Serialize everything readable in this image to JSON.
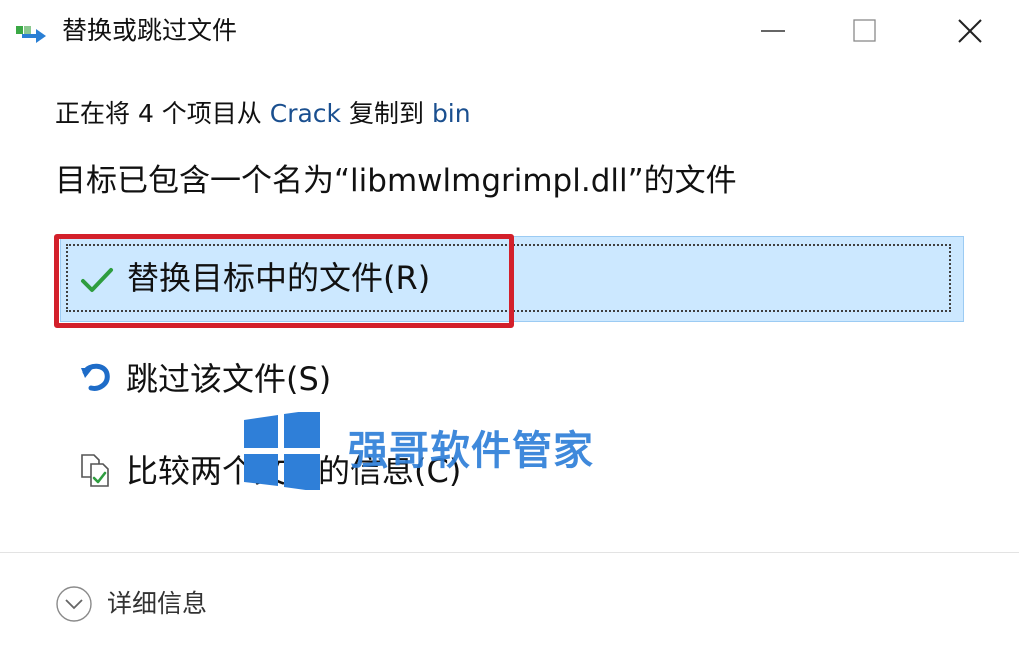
{
  "window": {
    "title": "替换或跳过文件"
  },
  "message": {
    "copy_prefix": "正在将 4 个项目从 ",
    "source": "Crack",
    "copy_middle": " 复制到 ",
    "destination": "bin",
    "conflict": "目标已包含一个名为“libmwlmgrimpl.dll”的文件"
  },
  "options": {
    "replace_label": "替换目标中的文件(R)",
    "skip_label": "跳过该文件(S)",
    "compare_label": "比较两个文件的信息(C)"
  },
  "watermark": {
    "text": "强哥软件管家"
  },
  "footer": {
    "details_label": "详细信息"
  },
  "colors": {
    "selection_bg": "#cce8ff",
    "highlight_border": "#d3202b",
    "link": "#1a4f8f",
    "watermark": "#2f7fd8",
    "check": "#2e9d3f"
  }
}
